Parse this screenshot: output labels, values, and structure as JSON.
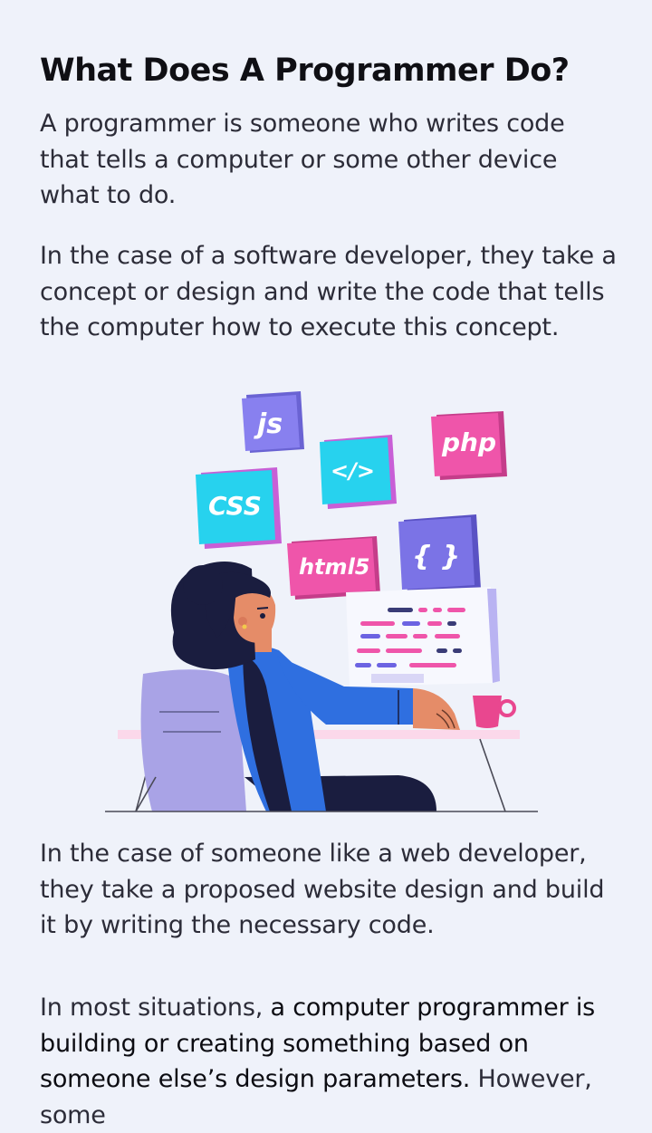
{
  "article": {
    "heading": "What Does A Programmer Do?",
    "para1": "A programmer is someone who writes code that tells a computer or some other device what to do.",
    "para2": "In the case of a software developer, they take a concept or design and write the code that tells the computer how to execute this concept.",
    "para3": "In the case of someone like a web developer, they take a proposed website design and build it by writing the necessary code.",
    "para4_intro": "In most situations, ",
    "para4_emphasis": "a computer programmer is building or creating something based on someone else’s design parameters.",
    "para4_rest": " However, some"
  },
  "illustration": {
    "tags": {
      "js": "js",
      "code": "</>",
      "php": "php",
      "css": "CSS",
      "html": "html5",
      "braces": "{ }"
    }
  },
  "colors": {
    "background": "#eff2fa",
    "purple": "#7b73e6",
    "cyan": "#26d3ef",
    "magenta": "#ec4fa6",
    "navy": "#1a1d3f",
    "blue": "#2f6fe0"
  }
}
